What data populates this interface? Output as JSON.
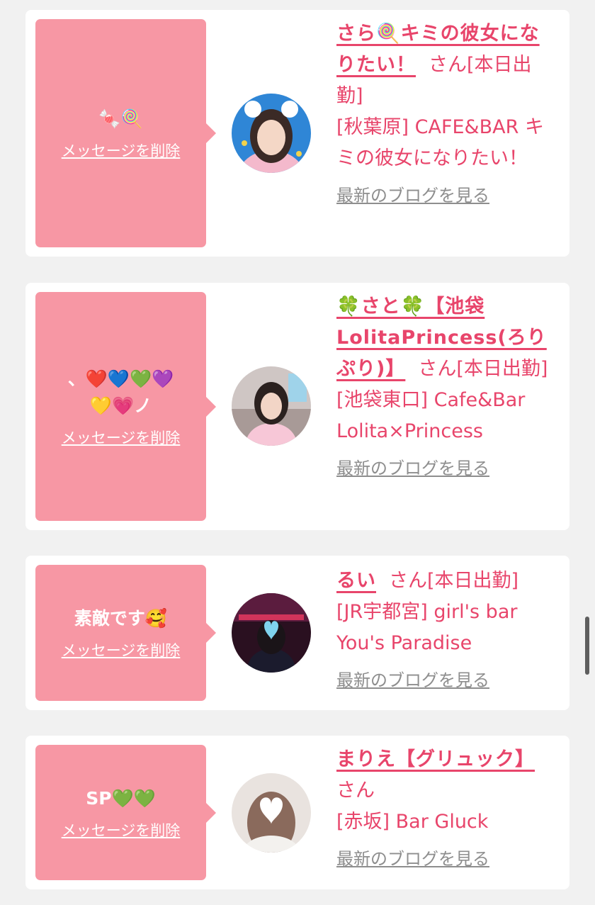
{
  "cards": [
    {
      "message": "🍬🍭",
      "delete_label": "メッセージを削除",
      "name": "さら🍭キミの彼女になりたい！",
      "suffix": "さん[本日出勤]",
      "shop": "[秋葉原] CAFE&BAR キミの彼女になりたい！",
      "blog_label": "最新のブログを見る"
    },
    {
      "message": "、❤️💙💚💜💛💗ノ",
      "delete_label": "メッセージを削除",
      "name": "🍀さと🍀【池袋LolitaPrincess(ろりぷり)】",
      "suffix": "さん[本日出勤]",
      "shop": "[池袋東口] Cafe&Bar Lolita×Princess",
      "blog_label": "最新のブログを見る"
    },
    {
      "message": "素敵です🥰",
      "delete_label": "メッセージを削除",
      "name": "るい",
      "suffix": "さん[本日出勤]",
      "shop": "[JR宇都宮] girl's bar You's Paradise",
      "blog_label": "最新のブログを見る"
    },
    {
      "message": "SP💚💚",
      "delete_label": "メッセージを削除",
      "name": "まりえ【グリュック】",
      "suffix": "さん",
      "shop": "[赤坂] Bar Gluck",
      "blog_label": "最新のブログを見る"
    }
  ],
  "colors": {
    "accent": "#e8456b",
    "bubble": "#f797a4",
    "link_gray": "#8e8e8e",
    "background": "#f1f1f1"
  }
}
